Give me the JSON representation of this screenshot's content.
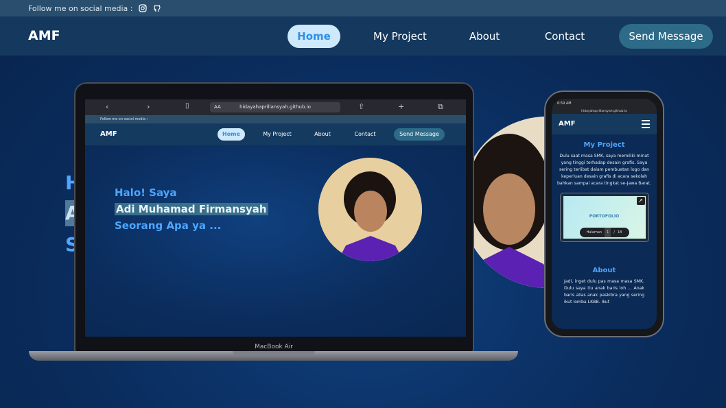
{
  "topbar": {
    "follow_text": "Follow me on social media :",
    "icons": [
      "instagram-icon",
      "github-icon"
    ]
  },
  "navbar": {
    "brand": "AMF",
    "items": [
      {
        "label": "Home",
        "active": true
      },
      {
        "label": "My Project"
      },
      {
        "label": "About"
      },
      {
        "label": "Contact"
      }
    ],
    "cta": "Send Message"
  },
  "laptop": {
    "url": "hidayahaprillansyah.github.io",
    "url_prefix": "AA",
    "model_label": "MacBook Air",
    "site": {
      "topbar_text": "Follow me on social media :",
      "brand": "AMF",
      "nav": [
        "Home",
        "My Project",
        "About",
        "Contact"
      ],
      "cta": "Send Message",
      "hero": {
        "line1": "Halo! Saya",
        "line2": "Adi Muhamad Firmansyah",
        "line3": "Seorang Apa ya ..."
      }
    }
  },
  "phone": {
    "time": "6:59 AM",
    "url": "hidayahaprillansyah.github.io",
    "brand": "AMF",
    "project_title": "My Project",
    "project_text": "Dulu saat masa SMK, saya memiliki minat yang tinggi terhadap desain grafis. Saya sering terlibat dalam pembuatan logo dan keperluan desain grafis di acara sekolah bahkan sampai acara tingkat se-Jawa Barat.",
    "card": {
      "label": "PORTOFOLIO",
      "page_label": "Halaman",
      "page": "1",
      "separator": "/",
      "total": "18"
    },
    "about_title": "About",
    "about_text": "Jadi, inget dulu pas masa masa SMK. Dulu saya itu anak baris loh ... Anak baris alias anak paskibra yang sering ikut lomba LKBB. Ikut"
  },
  "background_hero": {
    "ghost_h": "H",
    "ghost_a": "A",
    "ghost_s": "S"
  },
  "colors": {
    "accent": "#4ea6ff",
    "nav_bg": "#14385e",
    "topbar_bg": "#2a4f6e",
    "cta_bg": "#2d6b88",
    "active_pill": "#cde9fb"
  }
}
